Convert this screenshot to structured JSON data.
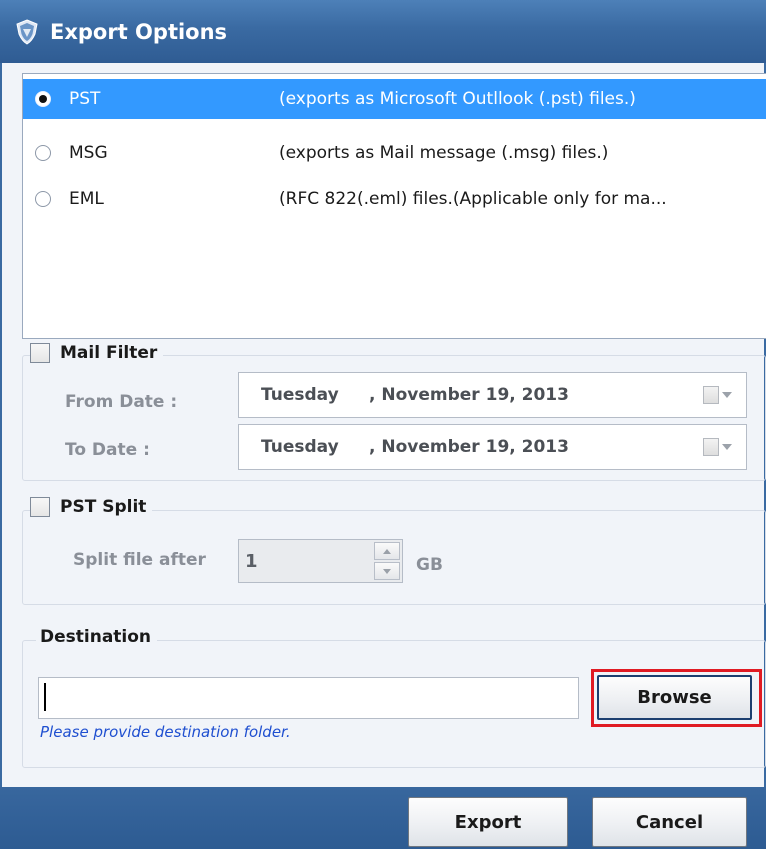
{
  "window": {
    "title": "Export Options",
    "icon": "app-shield-icon"
  },
  "formats": {
    "items": [
      {
        "name": "PST",
        "description": "(exports as Microsoft Outllook (.pst) files.)",
        "selected": true
      },
      {
        "name": "MSG",
        "description": "(exports as Mail message (.msg) files.)",
        "selected": false
      },
      {
        "name": "EML",
        "description": "(RFC 822(.eml) files.(Applicable only for ma...",
        "selected": false
      }
    ]
  },
  "mail_filter": {
    "label": "Mail Filter",
    "checked": false,
    "from_label": "From Date :",
    "to_label": "To Date :",
    "from_date": {
      "day": "Tuesday",
      "rest": ", November 19, 2013"
    },
    "to_date": {
      "day": "Tuesday",
      "rest": ", November 19, 2013"
    }
  },
  "pst_split": {
    "label": "PST Split",
    "checked": false,
    "split_label": "Split file after",
    "value": "1",
    "unit": "GB"
  },
  "destination": {
    "label": "Destination",
    "value": "",
    "hint": "Please provide destination folder.",
    "browse_label": "Browse"
  },
  "footer": {
    "export_label": "Export",
    "cancel_label": "Cancel"
  },
  "colors": {
    "selection": "#3399ff",
    "titlebar": "#3a6aa2",
    "highlight": "#e01b24",
    "hint": "#1f4fd0"
  }
}
